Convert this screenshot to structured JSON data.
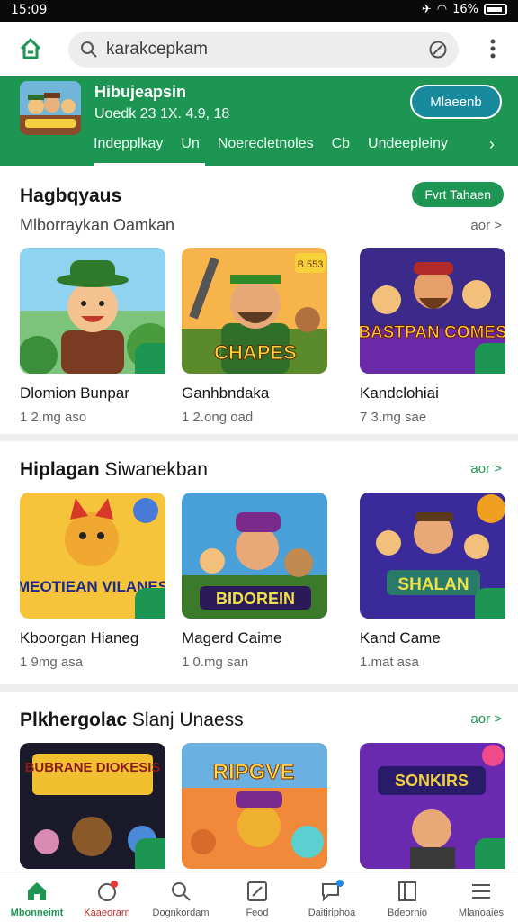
{
  "status": {
    "time": "15:09",
    "battery": "16%"
  },
  "search": {
    "value": "karakcepkam"
  },
  "banner": {
    "title": "Hibujeapsin",
    "subtitle": "Uoedk 23 1X. 4.9, 18",
    "action": "Mlaeenb",
    "tabs": [
      "Indepplkay",
      "Un",
      "Noerecletnoles",
      "Cb",
      "Undeepleiny"
    ]
  },
  "sections": [
    {
      "title": "Hagbqyaus",
      "subtitle": "Mlborraykan Oamkan",
      "pill": "Fvrt Tahaen",
      "more": "aor >",
      "cards": [
        {
          "name": "Dlomion Bunpar",
          "meta": "1 2.mg aso"
        },
        {
          "name": "Ganhbndaka",
          "meta": "1 2.ong oad"
        },
        {
          "name": "Kandclohiai",
          "meta": "7 3.mg sae"
        }
      ]
    },
    {
      "title": "Hiplagan",
      "title_rest": "Siwanekban",
      "more": "aor >",
      "cards": [
        {
          "name": "Kboorgan Hianeg",
          "meta": "1 9mg asa"
        },
        {
          "name": "Magerd Caime",
          "meta": "1 0.mg san"
        },
        {
          "name": "Kand Came",
          "meta": "1.mat asa"
        }
      ]
    },
    {
      "title": "Plkhergolac",
      "title_rest": "Slanj Unaess",
      "more": "aor >",
      "cards": [
        {
          "name": "",
          "meta": ""
        },
        {
          "name": "",
          "meta": ""
        },
        {
          "name": "",
          "meta": ""
        }
      ]
    }
  ],
  "art_text": {
    "card1_2": "CHAPES",
    "card1_2_tag": "B 553",
    "card1_3": "BASTPAN COMES",
    "card2_1": "MEOTIEAN VILANES",
    "card2_2": "BIDOREIN",
    "card2_3": "SHALAN",
    "card3_1": "BUBRANE DIOKESIS",
    "card3_2": "RIPGVE",
    "card3_3": "SONKIRS"
  },
  "bottom_nav": [
    {
      "label": "Mbonneimt",
      "icon": "home-icon"
    },
    {
      "label": "Kaaeorarn",
      "icon": "gift-icon"
    },
    {
      "label": "Dognkordam",
      "icon": "search-icon"
    },
    {
      "label": "Feod",
      "icon": "edit-icon"
    },
    {
      "label": "Daitiriphoa",
      "icon": "chat-icon"
    },
    {
      "label": "Bdeornio",
      "icon": "book-icon"
    },
    {
      "label": "Mlanoaies",
      "icon": "menu-icon"
    }
  ],
  "colors": {
    "accent": "#1e9653",
    "banner": "#1e9653",
    "action": "#188a9e"
  }
}
